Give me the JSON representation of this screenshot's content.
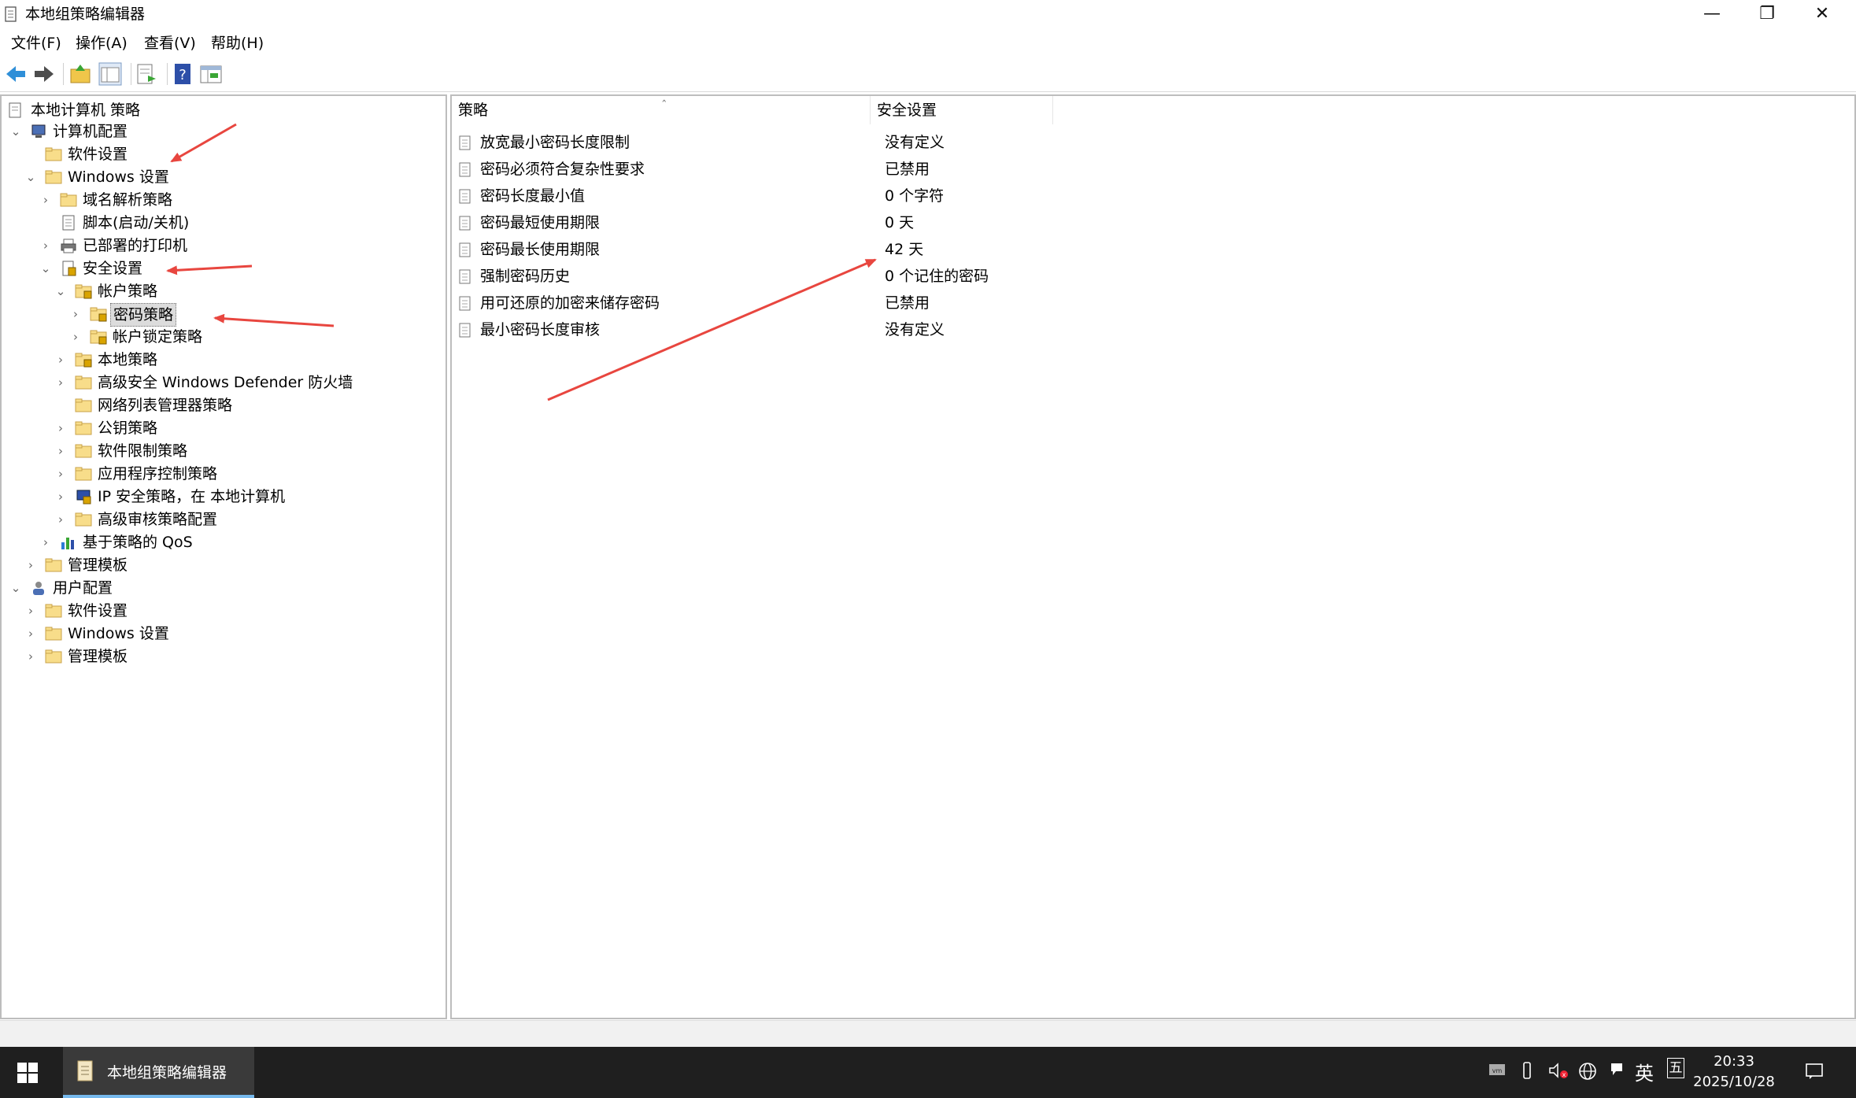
{
  "window": {
    "title": "本地组策略编辑器",
    "controls": {
      "minimize": "—",
      "maximize": "❐",
      "close": "✕"
    }
  },
  "menu": [
    "文件(F)",
    "操作(A)",
    "查看(V)",
    "帮助(H)"
  ],
  "toolbar": {
    "buttons": [
      "back-icon",
      "forward-icon",
      "up-folder-icon",
      "show-tree-icon",
      "export-list-icon",
      "help-icon",
      "properties-icon"
    ]
  },
  "tree": {
    "root": "本地计算机 策略",
    "items": [
      {
        "label": "计算机配置",
        "icon": "computer-icon",
        "chevron": "⌄"
      },
      {
        "label": "软件设置",
        "icon": "folder-icon",
        "chevron": ""
      },
      {
        "label": "Windows 设置",
        "icon": "folder-icon",
        "chevron": "⌄"
      },
      {
        "label": "域名解析策略",
        "icon": "folder-icon",
        "chevron": "›"
      },
      {
        "label": "脚本(启动/关机)",
        "icon": "script-icon",
        "chevron": ""
      },
      {
        "label": "已部署的打印机",
        "icon": "printer-icon",
        "chevron": "›"
      },
      {
        "label": "安全设置",
        "icon": "security-icon",
        "chevron": "⌄"
      },
      {
        "label": "帐户策略",
        "icon": "folder-lock-icon",
        "chevron": "⌄"
      },
      {
        "label": "密码策略",
        "icon": "folder-lock-icon",
        "chevron": "›",
        "selected": true
      },
      {
        "label": "帐户锁定策略",
        "icon": "folder-lock-icon",
        "chevron": "›"
      },
      {
        "label": "本地策略",
        "icon": "folder-lock-icon",
        "chevron": "›"
      },
      {
        "label": "高级安全 Windows Defender 防火墙",
        "icon": "folder-icon",
        "chevron": "›"
      },
      {
        "label": "网络列表管理器策略",
        "icon": "folder-icon",
        "chevron": ""
      },
      {
        "label": "公钥策略",
        "icon": "folder-icon",
        "chevron": "›"
      },
      {
        "label": "软件限制策略",
        "icon": "folder-icon",
        "chevron": "›"
      },
      {
        "label": "应用程序控制策略",
        "icon": "folder-icon",
        "chevron": "›"
      },
      {
        "label": "IP 安全策略，在 本地计算机",
        "icon": "ip-security-icon",
        "chevron": "›"
      },
      {
        "label": "高级审核策略配置",
        "icon": "folder-icon",
        "chevron": "›"
      },
      {
        "label": "基于策略的 QoS",
        "icon": "qos-chart-icon",
        "chevron": "›"
      },
      {
        "label": "管理模板",
        "icon": "folder-icon",
        "chevron": "›"
      },
      {
        "label": "用户配置",
        "icon": "user-icon",
        "chevron": "⌄"
      },
      {
        "label": "软件设置",
        "icon": "folder-icon",
        "chevron": "›"
      },
      {
        "label": "Windows 设置",
        "icon": "folder-icon",
        "chevron": "›"
      },
      {
        "label": "管理模板",
        "icon": "folder-icon",
        "chevron": "›"
      }
    ]
  },
  "list": {
    "sort_indicator": "ˆ",
    "columns": [
      "策略",
      "安全设置"
    ],
    "rows": [
      {
        "policy": "放宽最小密码长度限制",
        "setting": "没有定义"
      },
      {
        "policy": "密码必须符合复杂性要求",
        "setting": "已禁用"
      },
      {
        "policy": "密码长度最小值",
        "setting": "0 个字符"
      },
      {
        "policy": "密码最短使用期限",
        "setting": "0 天"
      },
      {
        "policy": "密码最长使用期限",
        "setting": "42 天"
      },
      {
        "policy": "强制密码历史",
        "setting": "0 个记住的密码"
      },
      {
        "policy": "用可还原的加密来储存密码",
        "setting": "已禁用"
      },
      {
        "policy": "最小密码长度审核",
        "setting": "没有定义"
      }
    ]
  },
  "taskbar": {
    "app_label": "本地组策略编辑器",
    "tray": [
      "vmware-tray-icon",
      "usb-icon",
      "volume-muted-icon",
      "network-globe-icon",
      "message-flag-icon"
    ],
    "ime": "英",
    "ime2": "五",
    "time": "20:33",
    "date": "2025/10/28"
  },
  "colors": {
    "annotation_arrow": "#e8463f",
    "taskbar": "#1f1f1f",
    "folder": "#f8dd8a"
  }
}
